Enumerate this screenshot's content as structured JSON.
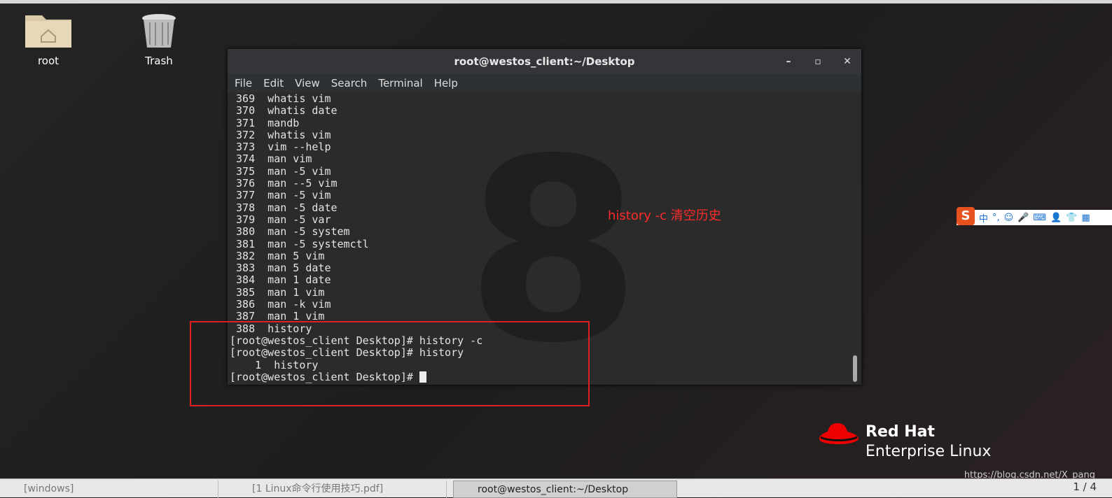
{
  "desktop": {
    "icons": [
      {
        "label": "root",
        "icon": "folder-home-icon"
      },
      {
        "label": "Trash",
        "icon": "trash-icon"
      }
    ]
  },
  "window": {
    "title": "root@westos_client:~/Desktop",
    "controls": [
      "minimize",
      "maximize",
      "close"
    ],
    "menu": [
      "File",
      "Edit",
      "View",
      "Search",
      "Terminal",
      "Help"
    ],
    "lines": [
      " 369  whatis vim",
      " 370  whatis date",
      " 371  mandb",
      " 372  whatis vim",
      " 373  vim --help",
      " 374  man vim",
      " 375  man -5 vim",
      " 376  man --5 vim",
      " 377  man -5 vim",
      " 378  man -5 date",
      " 379  man -5 var",
      " 380  man -5 system",
      " 381  man -5 systemctl",
      " 382  man 5 vim",
      " 383  man 5 date",
      " 384  man 1 date",
      " 385  man 1 vim",
      " 386  man -k vim",
      " 387  man 1 vim",
      " 388  history",
      "[root@westos_client Desktop]# history -c",
      "[root@westos_client Desktop]# history",
      "    1  history"
    ],
    "prompt": "[root@westos_client Desktop]# "
  },
  "annotation": {
    "text": "history -c 清空历史",
    "color": "#ff2a2a"
  },
  "ime": {
    "items": [
      "S",
      "中",
      "°,",
      "☺",
      "🎤",
      "⌨",
      "👤",
      "👕",
      "▦"
    ]
  },
  "logo": {
    "line1": "Red Hat",
    "line2": "Enterprise Linux"
  },
  "taskbar": {
    "items": [
      "[windows]",
      "[1 Linux命令行使用技巧.pdf]",
      "root@westos_client:~/Desktop"
    ],
    "pager": "1 / 4"
  },
  "watermark": "https://blog.csdn.net/X_pang"
}
